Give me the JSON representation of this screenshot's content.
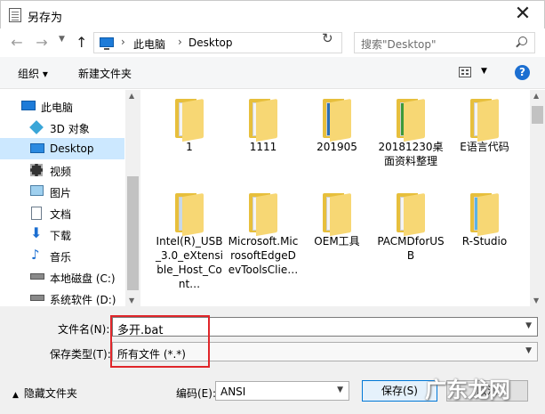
{
  "window": {
    "title": "另存为",
    "close_glyph": "✕"
  },
  "address": {
    "crumbs": [
      "此电脑",
      "Desktop"
    ],
    "separator": "›",
    "search_placeholder": "搜索\"Desktop\""
  },
  "toolbar": {
    "organize": "组织 ▾",
    "new_folder": "新建文件夹",
    "help": "?"
  },
  "sidebar": {
    "items": [
      {
        "label": "此电脑",
        "icon": "pc-icon"
      },
      {
        "label": "3D 对象",
        "icon": "cube-icon"
      },
      {
        "label": "Desktop",
        "icon": "desktop-icon",
        "selected": true
      },
      {
        "label": "视频",
        "icon": "video-icon"
      },
      {
        "label": "图片",
        "icon": "picture-icon"
      },
      {
        "label": "文档",
        "icon": "document-icon"
      },
      {
        "label": "下载",
        "icon": "download-icon"
      },
      {
        "label": "音乐",
        "icon": "music-icon"
      },
      {
        "label": "本地磁盘 (C:)",
        "icon": "disk-icon"
      },
      {
        "label": "系统软件 (D:)",
        "icon": "disk-icon"
      }
    ]
  },
  "folders": [
    {
      "label": "1"
    },
    {
      "label": "1111"
    },
    {
      "label": "201905"
    },
    {
      "label": "20181230桌面资料整理"
    },
    {
      "label": "E语言代码"
    },
    {
      "label": "Intel(R)_USB_3.0_eXtensible_Host_Cont…"
    },
    {
      "label": "Microsoft.MicrosoftEdgeDevToolsClie…"
    },
    {
      "label": "OEM工具"
    },
    {
      "label": "PACMDforUSB"
    },
    {
      "label": "R-Studio"
    }
  ],
  "form": {
    "filename_label": "文件名(N):",
    "filename_value": "多开.bat",
    "filetype_label": "保存类型(T):",
    "filetype_value": "所有文件  (*.*)",
    "hide_folders": "隐藏文件夹",
    "encoding_label": "编码(E):",
    "encoding_value": "ANSI",
    "save_button": "保存(S)",
    "cancel_button": "取消"
  },
  "watermark": "广东龙网"
}
